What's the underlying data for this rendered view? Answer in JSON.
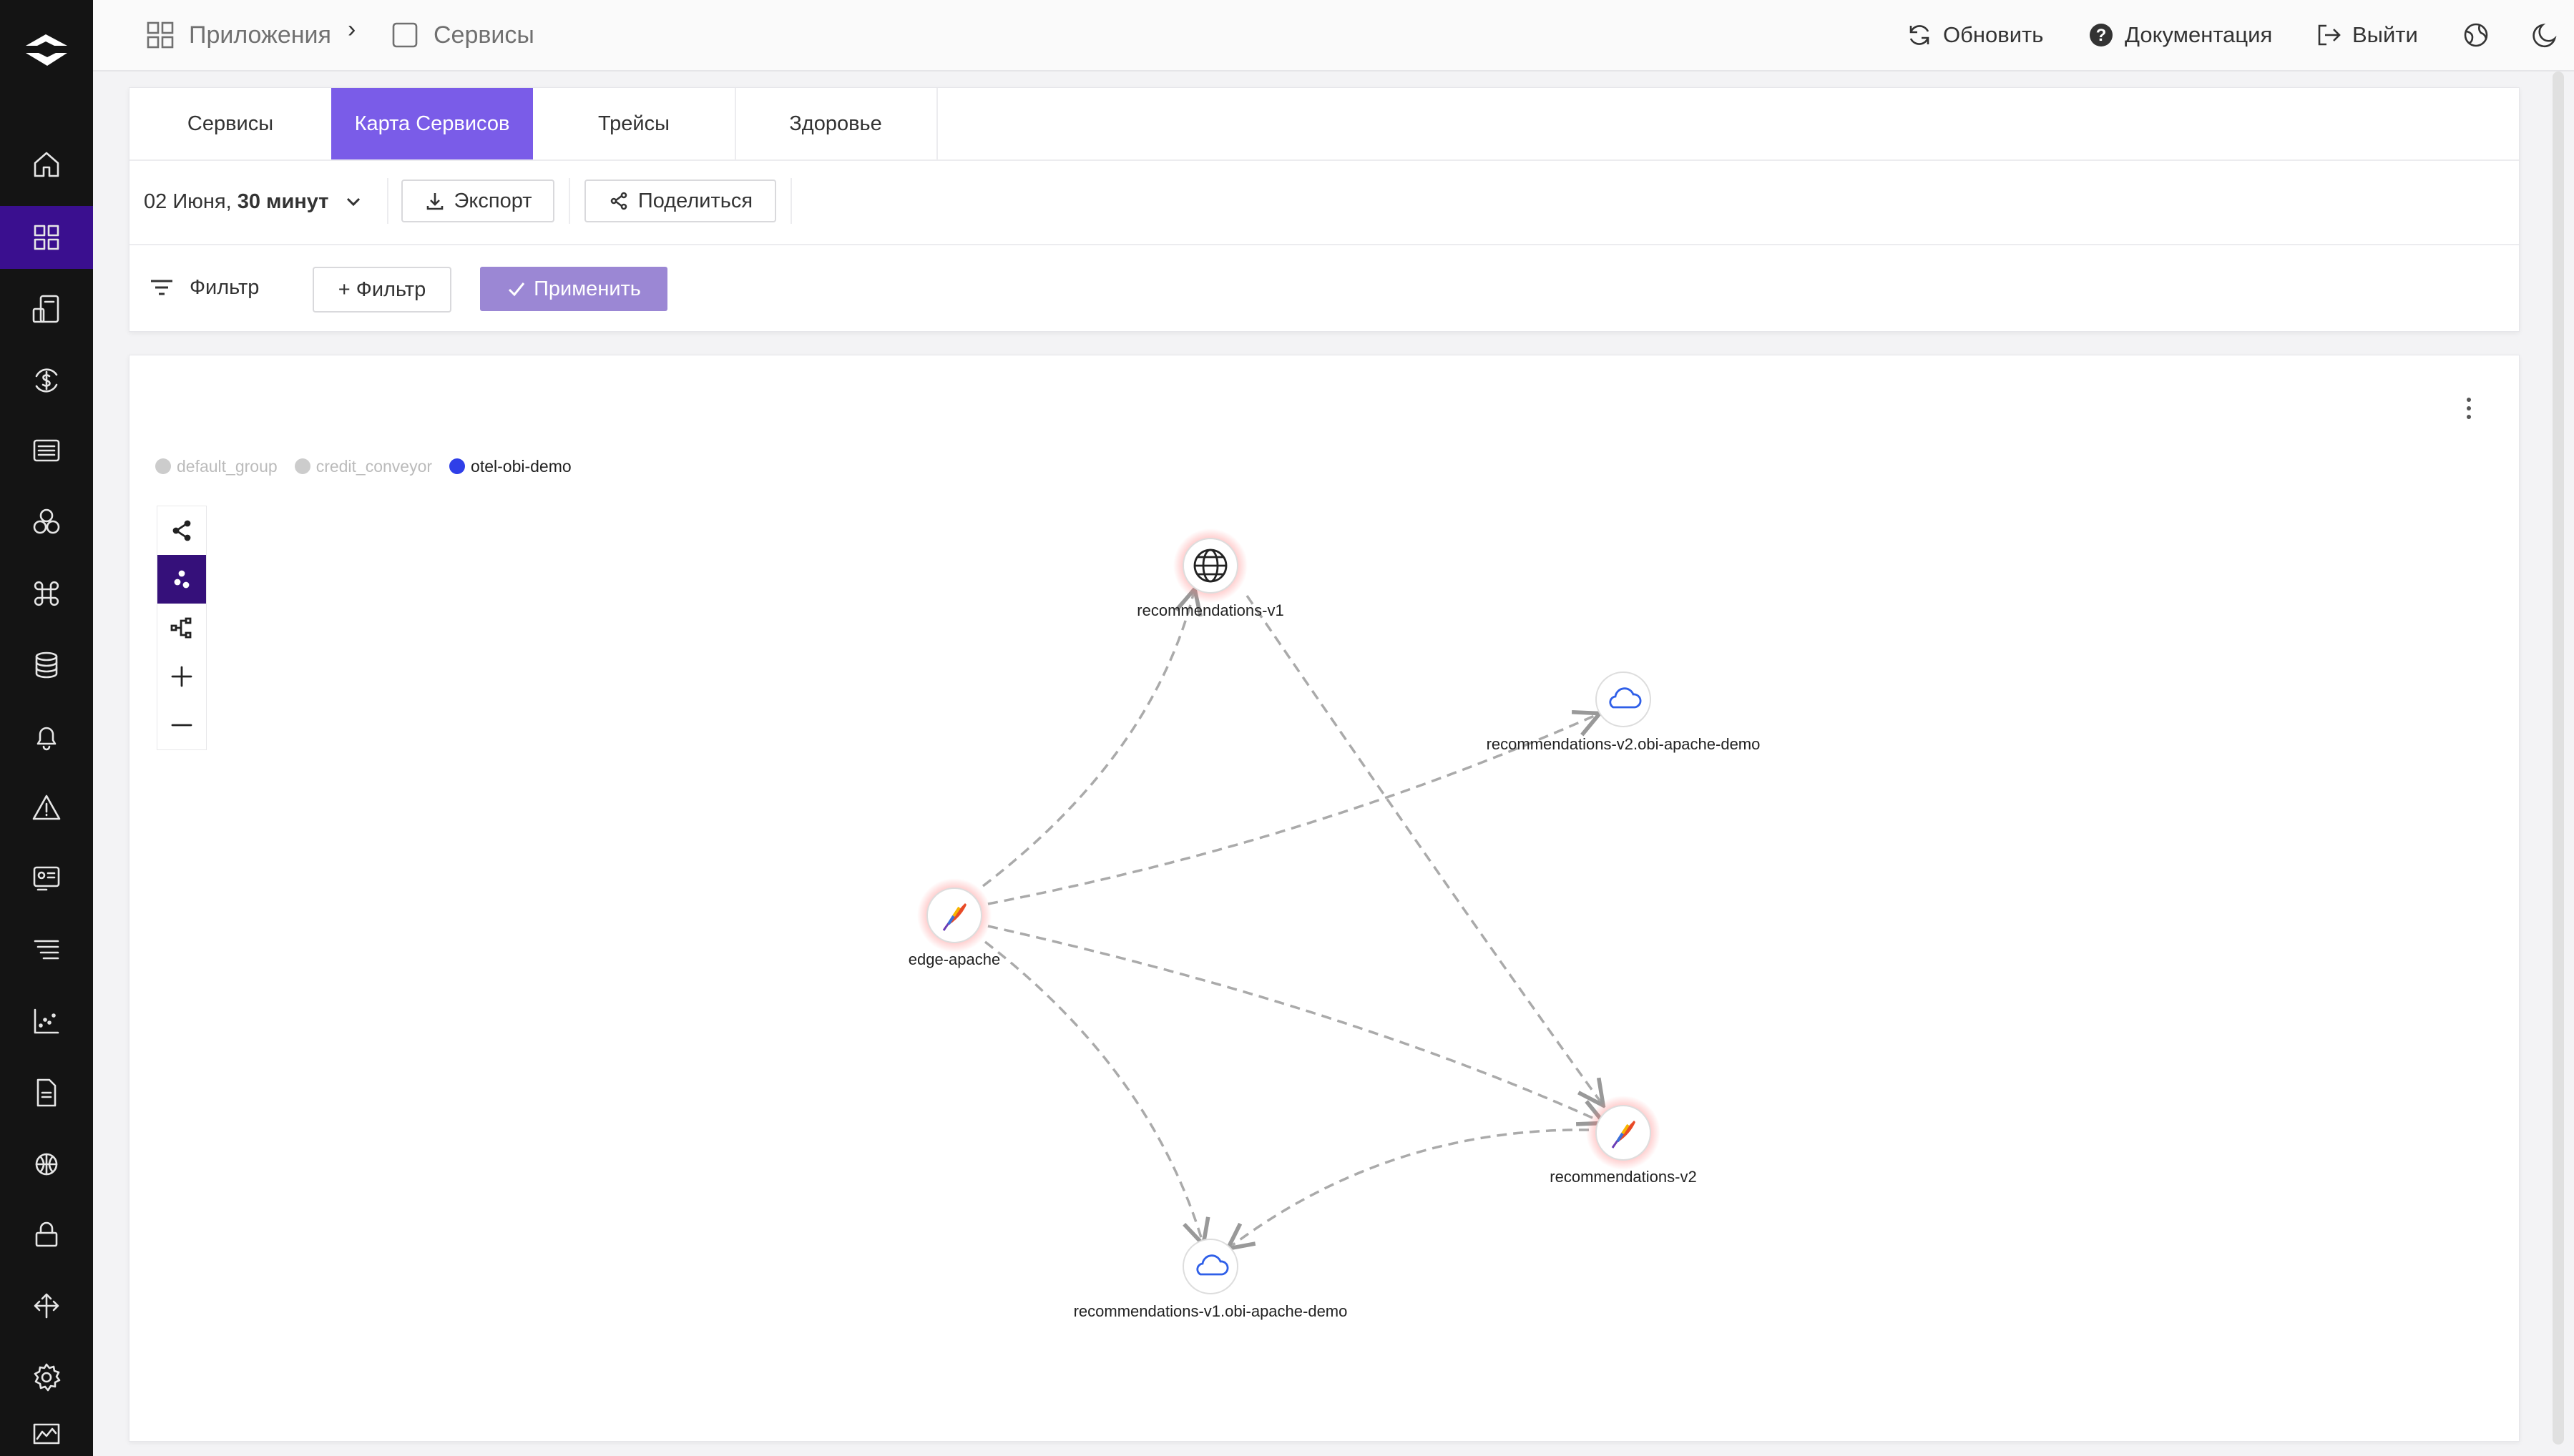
{
  "header": {
    "breadcrumb_apps": "Приложения",
    "breadcrumb_sep": "›",
    "breadcrumb_current": "Сервисы",
    "refresh": "Обновить",
    "docs": "Документация",
    "logout": "Выйти"
  },
  "sidebar": {
    "items": [
      "home-icon",
      "apps-icon",
      "devices-icon",
      "billing-icon",
      "list-icon",
      "hexagons-icon",
      "command-icon",
      "database-icon",
      "bell-icon",
      "alert-icon",
      "id-card-icon",
      "stack-icon",
      "chart-icon",
      "document-icon",
      "network-icon",
      "lock-icon",
      "arrows-icon",
      "gear-icon",
      "monitor-icon"
    ],
    "active_index": 1
  },
  "tabs": [
    {
      "label": "Сервисы",
      "active": false
    },
    {
      "label": "Карта Сервисов",
      "active": true
    },
    {
      "label": "Трейсы",
      "active": false
    },
    {
      "label": "Здоровье",
      "active": false
    }
  ],
  "toolbar": {
    "date_prefix": "02 Июня,",
    "date_range": "30 минут",
    "export": "Экспорт",
    "share": "Поделиться"
  },
  "filter": {
    "label": "Фильтр",
    "add_filter": "+ Фильтр",
    "apply": "Применить"
  },
  "legend": [
    {
      "name": "default_group",
      "color": "#cccccc",
      "active": false
    },
    {
      "name": "credit_conveyor",
      "color": "#cccccc",
      "active": false
    },
    {
      "name": "otel-obi-demo",
      "color": "#2f3fe8",
      "active": true
    }
  ],
  "graph": {
    "nodes": [
      {
        "id": "recommendations-v1",
        "label": "recommendations-v1",
        "icon": "globe-icon",
        "highlight": true
      },
      {
        "id": "recommendations-v2-db",
        "label": "recommendations-v2.obi-apache-demo",
        "icon": "cloud-icon",
        "highlight": false
      },
      {
        "id": "edge-apache",
        "label": "edge-apache",
        "icon": "apache-feather-icon",
        "highlight": true
      },
      {
        "id": "recommendations-v2",
        "label": "recommendations-v2",
        "icon": "apache-feather-icon",
        "highlight": true
      },
      {
        "id": "recommendations-v1-db",
        "label": "recommendations-v1.obi-apache-demo",
        "icon": "cloud-icon",
        "highlight": false
      }
    ],
    "edges": [
      {
        "from": "edge-apache",
        "to": "recommendations-v1"
      },
      {
        "from": "edge-apache",
        "to": "recommendations-v2-db"
      },
      {
        "from": "edge-apache",
        "to": "recommendations-v2"
      },
      {
        "from": "edge-apache",
        "to": "recommendations-v1-db"
      },
      {
        "from": "recommendations-v1",
        "to": "recommendations-v2"
      },
      {
        "from": "recommendations-v2",
        "to": "recommendations-v1-db"
      }
    ]
  },
  "colors": {
    "accent": "#7a5ce8",
    "sidebar_active": "#3a0f8f",
    "apply_button": "#9b87d4",
    "node_glow": "#ff6b6b"
  }
}
